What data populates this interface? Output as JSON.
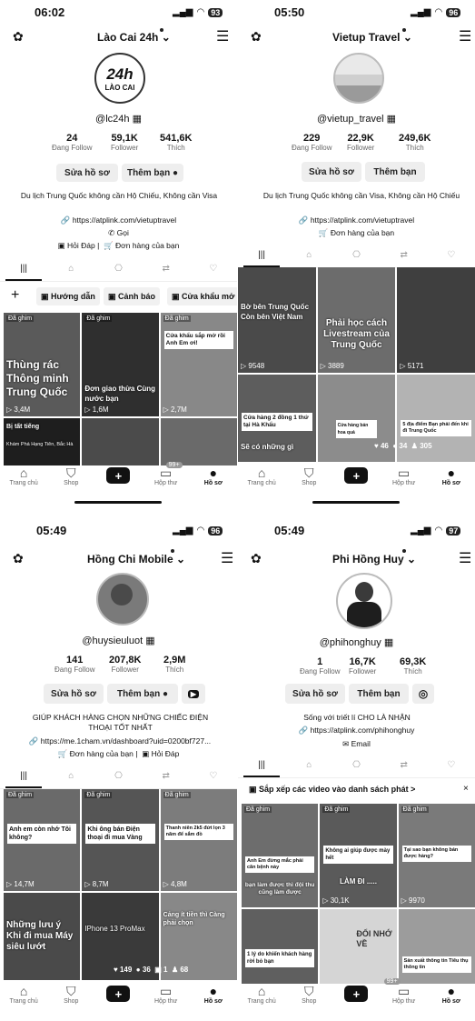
{
  "icons": {
    "gear": "gear-icon",
    "menu": "☰"
  },
  "panels": [
    {
      "time": "06:02",
      "battery": "93",
      "name": "Lào Cai 24h",
      "handle": "@lc24h",
      "avatar_text": "24h",
      "avatar_sub": "LÀO CAI",
      "stats": [
        {
          "n": "24",
          "l": "Đang Follow"
        },
        {
          "n": "59,1K",
          "l": "Follower"
        },
        {
          "n": "541,6K",
          "l": "Thích"
        }
      ],
      "btn_edit": "Sửa hồ sơ",
      "btn_friend": "Thêm bạn",
      "bio": "Du lịch Trung Quốc không cần Hộ Chiếu, Không cần Visa",
      "link": "https://atplink.com/vietuptravel",
      "call": "Gọi",
      "links2": [
        "Hỏi Đáp",
        "Đơn hàng của bạn"
      ],
      "chips": [
        "Hướng dẫn",
        "Cảnh báo",
        "Cửa khẩu mở"
      ],
      "videos": [
        {
          "pin": "Đã ghim",
          "cap": "Thùng rác Thông minh Trung Quốc",
          "views": "3,4M"
        },
        {
          "pin": "Đã ghim",
          "cap": "Đơn giao thừa Cùng nước bạn",
          "views": "1,6M"
        },
        {
          "pin": "Đã ghim",
          "box": "Cửa khẩu sắp mở rồi Anh Em ơi!",
          "views": "2,7M"
        },
        {
          "box": "Bị tất tiếng",
          "cap": "Khám Phá Hạng Tiên, Bắc Hà"
        },
        {},
        {}
      ],
      "nav": [
        "Trang chủ",
        "Shop",
        "",
        "Hộp thư",
        "Hồ sơ"
      ],
      "inbox_badge": "99+"
    },
    {
      "time": "05:50",
      "battery": "96",
      "name": "Vietup Travel",
      "handle": "@vietup_travel",
      "stats": [
        {
          "n": "229",
          "l": "Đang Follow"
        },
        {
          "n": "22,9K",
          "l": "Follower"
        },
        {
          "n": "249,6K",
          "l": "Thích"
        }
      ],
      "btn_edit": "Sửa hồ sơ",
      "btn_friend": "Thêm bạn",
      "bio": "Du lịch Trung Quốc không cần Visa, Không cần Hộ Chiếu",
      "link": "https://atplink.com/vietuptravel",
      "links2": [
        "Đơn hàng của bạn"
      ],
      "videos": [
        {
          "cap": "Bờ bên Trung Quốc Còn bên Việt Nam",
          "views": "9548"
        },
        {
          "cap": "Phải học cách Livestream của Trung Quốc",
          "views": "3889"
        },
        {
          "views": "5171"
        },
        {
          "box": "Cửa hàng 2 đồng 1 thứ tại Hà Khẩu",
          "cap": "Sẽ có những gì"
        },
        {
          "box": "Cửa hàng bán hoa quả"
        },
        {
          "box": "5 địa điểm Bạn phải đến khi đi Trung Quốc"
        }
      ],
      "engagement": {
        "likes": "46",
        "comments": "34",
        "users": "305"
      },
      "nav": [
        "Trang chủ",
        "Shop",
        "",
        "Hộp thư",
        "Hồ sơ"
      ]
    },
    {
      "time": "05:49",
      "battery": "96",
      "name": "Hồng Chi Mobile",
      "handle": "@huysieuluot",
      "stats": [
        {
          "n": "141",
          "l": "Đang Follow"
        },
        {
          "n": "207,8K",
          "l": "Follower"
        },
        {
          "n": "2,9M",
          "l": "Thích"
        }
      ],
      "btn_edit": "Sửa hồ sơ",
      "btn_friend": "Thêm bạn",
      "bio": "GIÚP KHÁCH HÀNG CHỌN NHỮNG CHIẾC ĐIỆN THOẠI TỐT NHẤT",
      "link": "https://me.1cham.vn/dashboard?uid=0200bf727...",
      "links2": [
        "Đơn hàng của bạn",
        "Hỏi Đáp"
      ],
      "videos": [
        {
          "pin": "Đã ghim",
          "box": "Anh em còn nhớ Tôi không?",
          "views": "14,7M"
        },
        {
          "pin": "Đã ghim",
          "box": "Khi ông bán Điện thoại đi mua Vàng",
          "views": "8,7M"
        },
        {
          "pin": "Đã ghim",
          "box": "Thanh niên 2k5 đứt lọn 3 năm để sắm đồ",
          "views": "4,8M"
        },
        {
          "cap": "Những lưu ý Khi đi mua Máy siêu lướt"
        },
        {
          "cap": "IPhone 13 ProMax"
        },
        {
          "cap": "Cảng ít tiền thì Càng phải chọn"
        }
      ],
      "engagement": {
        "likes": "149",
        "comments": "36",
        "shares": "1",
        "users": "68"
      },
      "nav": [
        "Trang chủ",
        "Shop",
        "",
        "Hộp thư",
        "Hồ sơ"
      ]
    },
    {
      "time": "05:49",
      "battery": "97",
      "name": "Phi Hồng Huy",
      "handle": "@phihonghuy",
      "stats": [
        {
          "n": "1",
          "l": "Đang Follow"
        },
        {
          "n": "16,7K",
          "l": "Follower"
        },
        {
          "n": "69,3K",
          "l": "Thích"
        }
      ],
      "btn_edit": "Sửa hồ sơ",
      "btn_friend": "Thêm bạn",
      "bio": "Sống với triết lí CHO LÀ NHẬN",
      "link": "https://atplink.com/phihonghuy",
      "email": "Email",
      "sort": "Sắp xếp các video vào danh sách phát >",
      "videos": [
        {
          "pin": "Đã ghim",
          "box": "Anh Em đừng mắc phải căn bệnh này",
          "cap": "bạn làm được thì đội thu cũng làm được"
        },
        {
          "pin": "Đã ghim",
          "box": "Không ai giúp được mày hết",
          "cap": "LÀM ĐI .....",
          "views": "30,1K"
        },
        {
          "pin": "Đã ghim",
          "box": "Tại sao bạn không bán được hàng?",
          "views": "9970"
        },
        {
          "box": "1 lý do khiến khách hàng rời bỏ bạn"
        },
        {
          "cap": "ĐỔI NHỚ VỀ"
        },
        {
          "box": "Sản xuất thông tin Tiêu thụ thông tin"
        }
      ],
      "nav": [
        "Trang chủ",
        "Shop",
        "",
        "Hộp thư",
        "Hồ sơ"
      ],
      "inbox_badge": "99+"
    }
  ]
}
